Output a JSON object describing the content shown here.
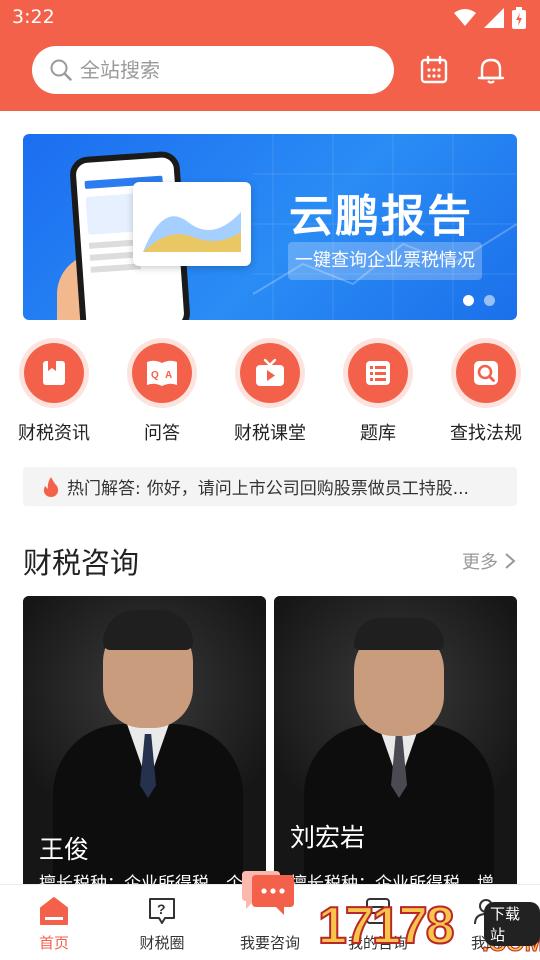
{
  "status_bar": {
    "time": "3:22"
  },
  "search": {
    "placeholder": "全站搜索"
  },
  "banner": {
    "title": "云鹏报告",
    "subtitle": "一键查询企业票税情况",
    "active_index": 0,
    "slide_count": 2
  },
  "categories": [
    {
      "label": "财税资讯",
      "icon": "document-icon"
    },
    {
      "label": "问答",
      "icon": "qa-book-icon"
    },
    {
      "label": "财税课堂",
      "icon": "tv-play-icon"
    },
    {
      "label": "题库",
      "icon": "list-icon"
    },
    {
      "label": "查找法规",
      "icon": "search-icon"
    }
  ],
  "hot_answer": {
    "prefix": "热门解答:",
    "text": "你好，请问上市公司回购股票做员工持股..."
  },
  "consult": {
    "title": "财税咨询",
    "more": "更多",
    "experts": [
      {
        "name": "王俊",
        "skill": "擅长税种：企业所得税、个"
      },
      {
        "name": "刘宏岩",
        "skill": "擅长税种：企业所得税、增"
      }
    ]
  },
  "tabs": [
    {
      "label": "首页",
      "icon": "home-icon",
      "active": true
    },
    {
      "label": "财税圈",
      "icon": "question-icon",
      "active": false
    },
    {
      "label": "我要咨询",
      "icon": "chat-bubble-icon",
      "active": false
    },
    {
      "label": "我的咨询",
      "icon": "consult-icon",
      "active": false
    },
    {
      "label": "我的",
      "icon": "user-icon",
      "active": false
    }
  ],
  "watermark": {
    "number": "17178",
    "domain": ".COM",
    "tag": "下载站"
  },
  "colors": {
    "brand": "#f4614a",
    "banner_blue": "#1c6ef0"
  }
}
